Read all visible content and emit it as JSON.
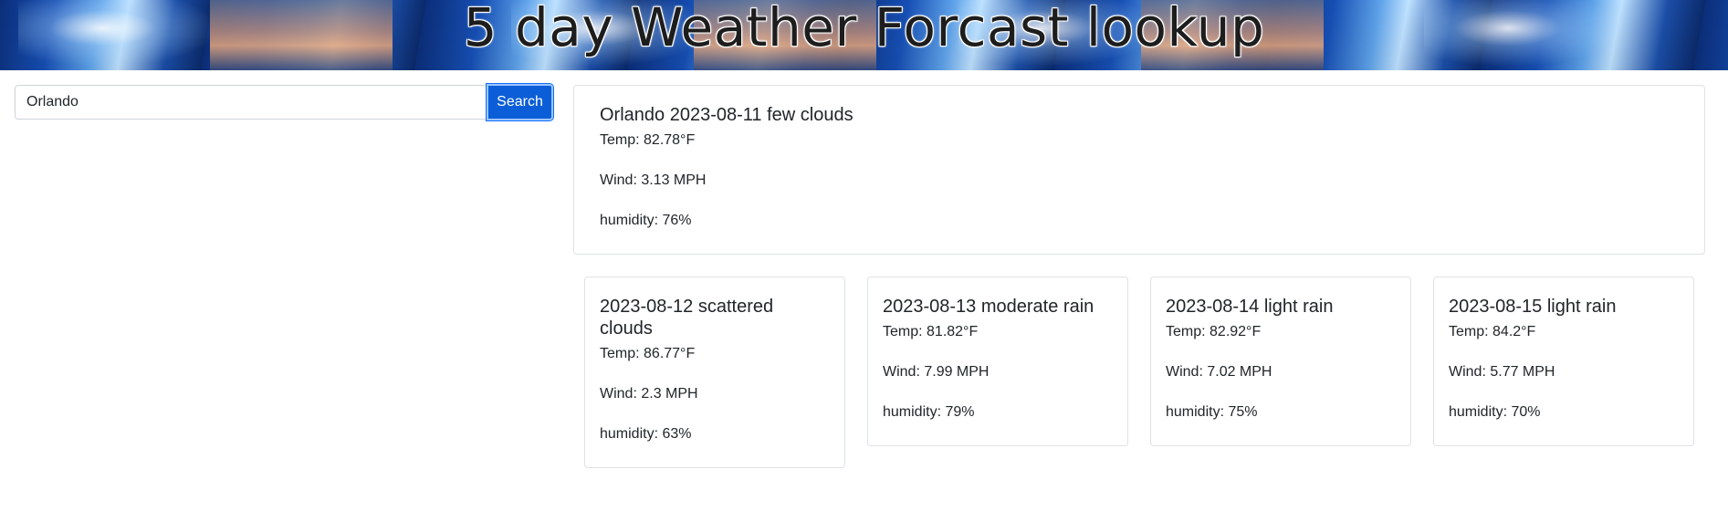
{
  "header": {
    "title": "5 day Weather Forcast lookup"
  },
  "search": {
    "value": "Orlando",
    "button_label": "Search"
  },
  "current": {
    "heading": "Orlando 2023-08-11 few clouds",
    "temp": "Temp: 82.78°F",
    "wind": "Wind: 3.13 MPH",
    "humidity": "humidity: 76%"
  },
  "forecast": [
    {
      "heading": "2023-08-12 scattered clouds",
      "temp": "Temp: 86.77°F",
      "wind": "Wind: 2.3 MPH",
      "humidity": "humidity: 63%"
    },
    {
      "heading": "2023-08-13 moderate rain",
      "temp": "Temp: 81.82°F",
      "wind": "Wind: 7.99 MPH",
      "humidity": "humidity: 79%"
    },
    {
      "heading": "2023-08-14 light rain",
      "temp": "Temp: 82.92°F",
      "wind": "Wind: 7.02 MPH",
      "humidity": "humidity: 75%"
    },
    {
      "heading": "2023-08-15 light rain",
      "temp": "Temp: 84.2°F",
      "wind": "Wind: 5.77 MPH",
      "humidity": "humidity: 70%"
    }
  ],
  "colors": {
    "primary_button": "#0b5ed7",
    "card_border": "#dee2e6",
    "text": "#212529"
  }
}
